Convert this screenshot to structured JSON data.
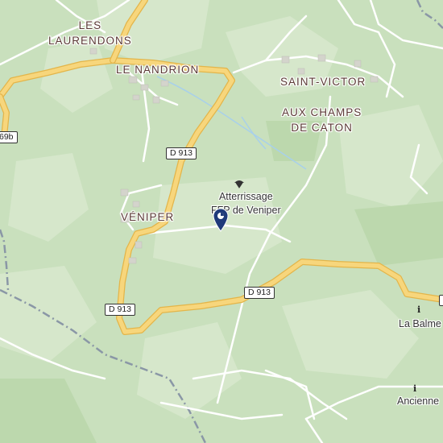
{
  "places": {
    "les_laurendons": "LES\nLAURENDONS",
    "le_nandrion": "LE NANDRION",
    "saint_victor": "SAINT-VICTOR",
    "aux_champs_de_caton": "AUX CHAMPS\nDE CATON",
    "veniper": "VÉNIPER"
  },
  "pois": {
    "atterrissage": "Atterrissage\nFFP de Veniper",
    "la_balme": "La Balme",
    "ancienne": "Ancienne"
  },
  "roads": {
    "d913_a": "D 913",
    "d913_b": "D 913",
    "d913_c": "D 913",
    "edge_road": "69b"
  },
  "icons": {
    "poi_icon": "paragliding-icon",
    "pin_icon": "map-pin-icon",
    "info_icon": "info-icon"
  },
  "colors": {
    "forest": "#c6dfb8",
    "open_land": "#d9e8cf",
    "major_road": "#f7d67c",
    "major_road_casing": "#e8b94c",
    "minor_road": "#ffffff",
    "stream": "#9cc8e6",
    "boundary": "#8a97a6",
    "pin": "#1f3a7a"
  }
}
